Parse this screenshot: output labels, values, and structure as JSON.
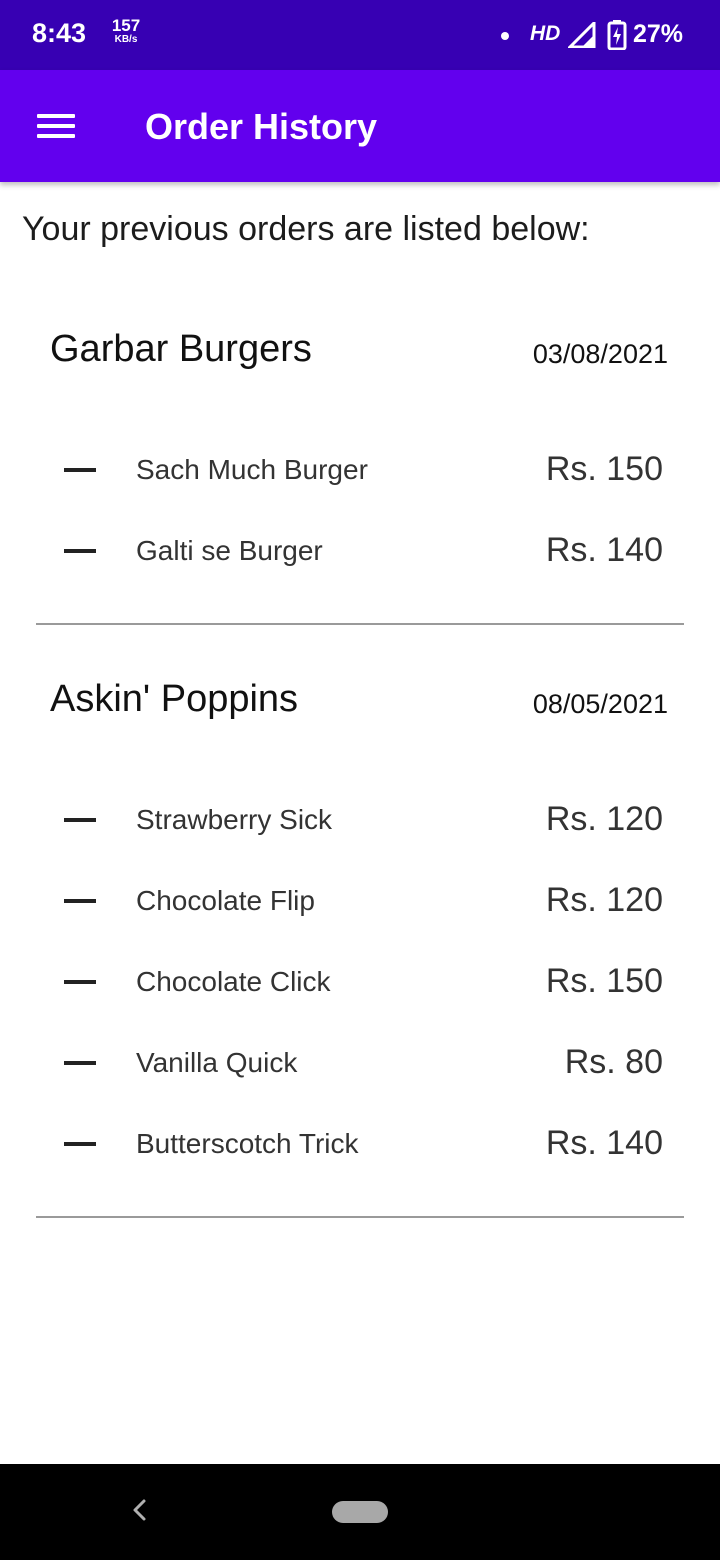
{
  "status_bar": {
    "time": "8:43",
    "speed_value": "157",
    "speed_unit": "KB/s",
    "network": "HD",
    "battery": "27%"
  },
  "app_bar": {
    "title": "Order History",
    "menu_icon": "hamburger-menu-icon"
  },
  "intro_text": "Your previous orders are listed below:",
  "orders": [
    {
      "restaurant": "Garbar Burgers",
      "date": "03/08/2021",
      "items": [
        {
          "name": "Sach Much Burger",
          "price": "Rs. 150"
        },
        {
          "name": "Galti se Burger",
          "price": "Rs. 140"
        }
      ]
    },
    {
      "restaurant": "Askin' Poppins",
      "date": "08/05/2021",
      "items": [
        {
          "name": "Strawberry Sick",
          "price": "Rs. 120"
        },
        {
          "name": "Chocolate Flip",
          "price": "Rs. 120"
        },
        {
          "name": "Chocolate Click",
          "price": "Rs. 150"
        },
        {
          "name": "Vanilla Quick",
          "price": "Rs. 80"
        },
        {
          "name": "Butterscotch Trick",
          "price": "Rs. 140"
        }
      ]
    }
  ],
  "colors": {
    "status_bar": "#3700b3",
    "app_bar": "#6200ee",
    "divider": "#9a9a9a",
    "nav_bar": "#000000"
  },
  "nav": {
    "back_icon": "back-chevron-icon",
    "home_icon": "home-pill-icon"
  }
}
